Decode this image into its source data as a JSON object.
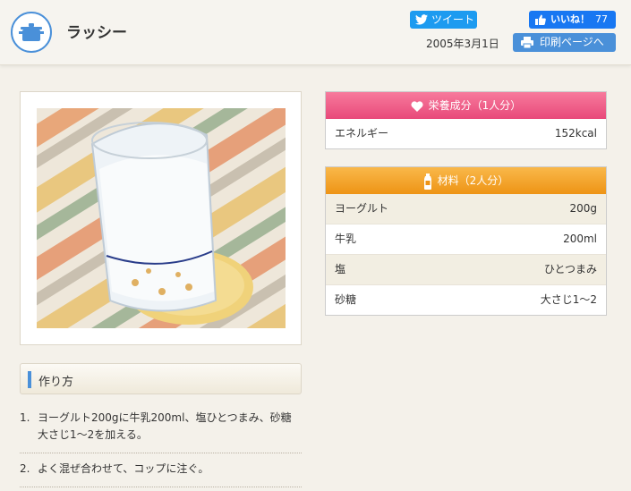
{
  "header": {
    "title": "ラッシー",
    "tweet_label": "ツイート",
    "like_label": "いいね！",
    "like_count": "77",
    "date": "2005年3月1日",
    "print_label": "印刷ページへ"
  },
  "method": {
    "heading": "作り方",
    "steps": [
      {
        "num": "1.",
        "text": "ヨーグルト200gに牛乳200ml、塩ひとつまみ、砂糖大さじ1～2を加える。"
      },
      {
        "num": "2.",
        "text": "よく混ぜ合わせて、コップに注ぐ。"
      }
    ]
  },
  "nutrition": {
    "heading": "栄養成分（1人分）",
    "rows": [
      {
        "label": "エネルギー",
        "value": "152kcal"
      }
    ]
  },
  "ingredients": {
    "heading": "材料（2人分）",
    "rows": [
      {
        "label": "ヨーグルト",
        "value": "200g"
      },
      {
        "label": "牛乳",
        "value": "200ml"
      },
      {
        "label": "塩",
        "value": "ひとつまみ"
      },
      {
        "label": "砂糖",
        "value": "大さじ1～2"
      }
    ]
  },
  "icons": {
    "logo": "pot-icon",
    "tweet": "twitter-bird-icon",
    "like": "thumbs-up-icon",
    "print": "printer-icon",
    "nutrition": "heart-icon",
    "ingredients": "bottle-icon"
  },
  "colors": {
    "accent_blue": "#4a90d9",
    "twitter": "#1d9bf0",
    "facebook": "#1877f2",
    "nutrition_pink": "#e8497a",
    "ingredients_orange": "#ee9415"
  }
}
